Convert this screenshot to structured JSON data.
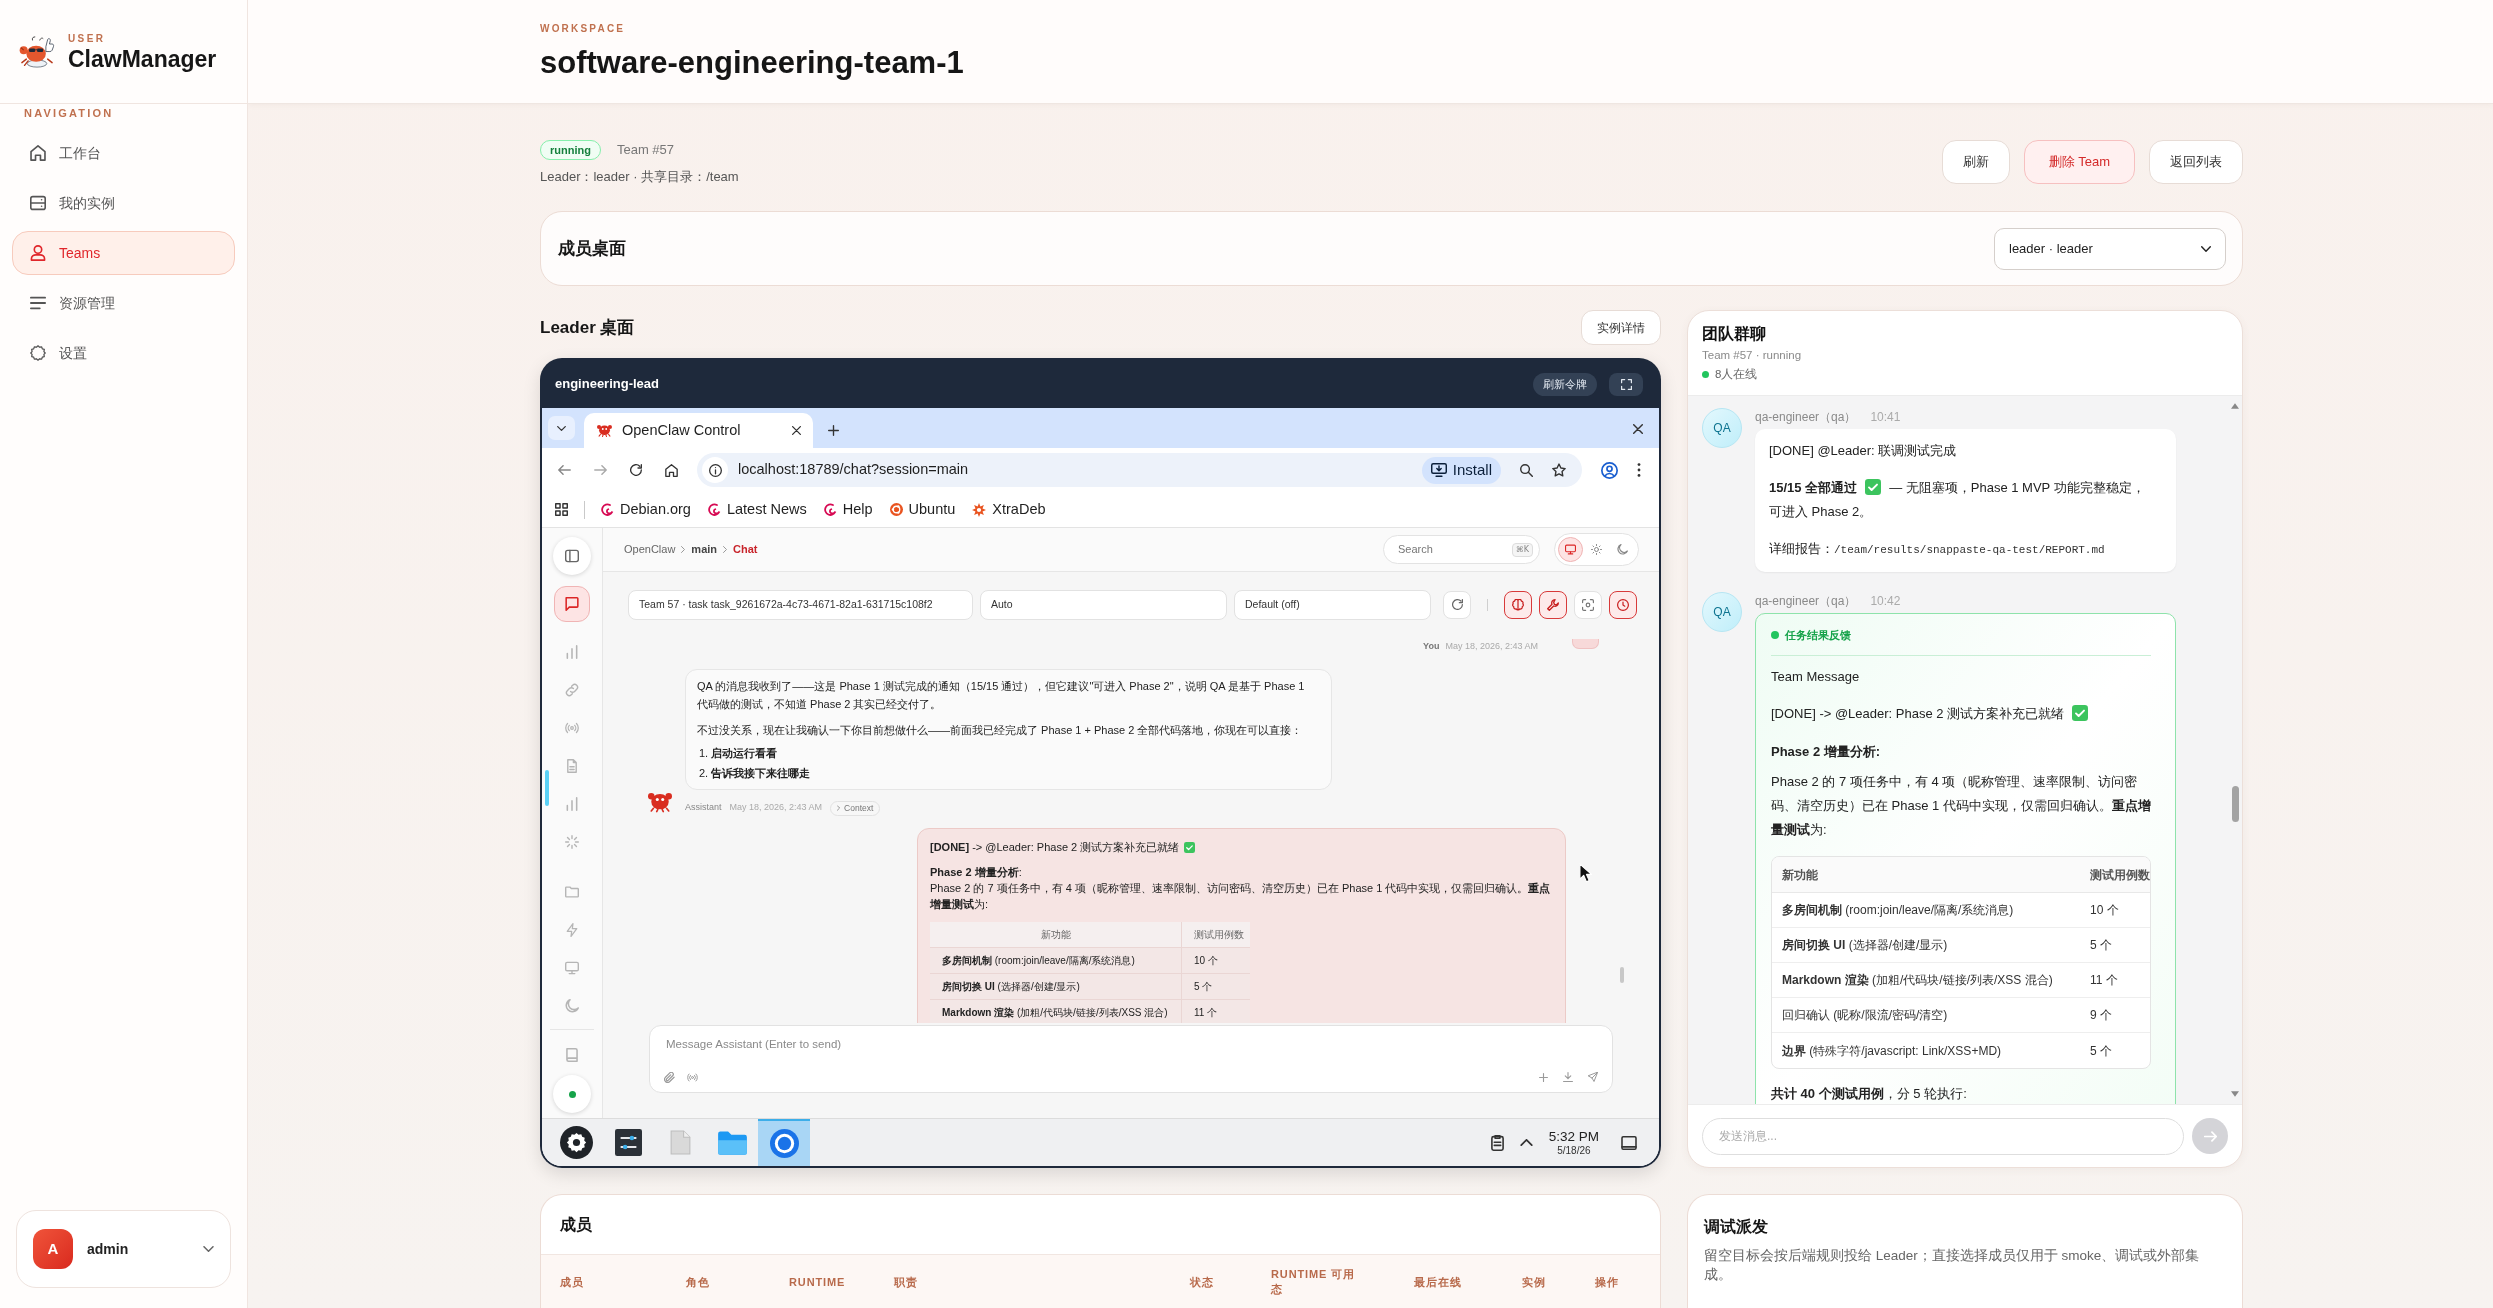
{
  "sidebar": {
    "brand_tag": "USER",
    "brand": "ClawManager",
    "nav_heading": "NAVIGATION",
    "items": [
      {
        "label": "工作台",
        "selected": false
      },
      {
        "label": "我的实例",
        "selected": false
      },
      {
        "label": "Teams",
        "selected": true
      },
      {
        "label": "资源管理",
        "selected": false
      },
      {
        "label": "设置",
        "selected": false
      }
    ],
    "user": {
      "avatar": "A",
      "name": "admin"
    }
  },
  "header": {
    "eyebrow": "WORKSPACE",
    "title": "software-engineering-team-1"
  },
  "team": {
    "status": "running",
    "number": "Team #57",
    "meta": "Leader：leader · 共享目录：/team",
    "actions": [
      {
        "label": "刷新",
        "kind": "plain"
      },
      {
        "label": "删除 Team",
        "kind": "danger"
      },
      {
        "label": "返回列表",
        "kind": "plain"
      }
    ]
  },
  "member_desktop": {
    "title": "成员桌面",
    "selected_member": "leader · leader"
  },
  "desktop": {
    "title": "Leader 桌面",
    "details_button": "实例详情",
    "window": {
      "title": "engineering-lead",
      "refresh_button": "刷新令牌"
    },
    "browser": {
      "tab_title": "OpenClaw Control",
      "url": "localhost:18789/chat?session=main",
      "install_button": "Install",
      "bookmarks": [
        {
          "label": "Debian.org",
          "kind": "swirl"
        },
        {
          "label": "Latest News",
          "kind": "swirl"
        },
        {
          "label": "Help",
          "kind": "swirl"
        },
        {
          "label": "Ubuntu",
          "kind": "ring"
        },
        {
          "label": "XtraDeb",
          "kind": "burst"
        }
      ]
    },
    "app": {
      "rail": [
        {
          "selected": false
        },
        {
          "selected": true
        },
        {
          "selected": false
        },
        {
          "selected": false
        },
        {
          "selected": false
        },
        {
          "selected": false
        },
        {
          "selected": false
        },
        {
          "selected": false
        },
        {
          "selected": false
        },
        {
          "selected": false
        },
        {
          "selected": false
        },
        {
          "selected": false
        },
        {
          "selected": false
        },
        {
          "selected": false
        }
      ],
      "breadcrumb": [
        {
          "label": "OpenClaw",
          "selected": false
        },
        {
          "label": "main",
          "selected": false
        },
        {
          "label": "Chat",
          "selected": true
        }
      ],
      "search": {
        "placeholder": "Search",
        "shortcut": "⌘K"
      },
      "theme_modes": [
        {
          "selected": true
        },
        {
          "selected": false
        },
        {
          "selected": false
        }
      ],
      "selects": [
        "Team 57 · task task_9261672a-4c73-4671-82a1-631715c108f2",
        "Auto",
        "Default (off)"
      ],
      "toggles": [
        {
          "on": true
        },
        {
          "on": true
        },
        {
          "on": false
        },
        {
          "on": true
        }
      ],
      "messages": [
        {
          "kind": "meta",
          "sender": "You",
          "time": "May 18, 2026, 2:43 AM"
        },
        {
          "kind": "assistant",
          "paragraphs": [
            "QA 的消息我收到了——这是 Phase 1 测试完成的通知（15/15 通过），但它建议\"可进入 Phase 2\"，说明 QA 是基于 Phase 1 代码做的测试，不知道 Phase 2 其实已经交付了。",
            "不过没关系，现在让我确认一下你目前想做什么——前面我已经完成了 Phase 1 + Phase 2 全部代码落地，你现在可以直接："
          ],
          "list": [
            {
              "marker": "1.",
              "text": "启动运行看看"
            },
            {
              "marker": "2.",
              "text": "告诉我接下来往哪走"
            }
          ],
          "sender": "Assistant",
          "time": "May 18, 2026, 2:43 AM",
          "context_button": "Context"
        },
        {
          "kind": "user",
          "blocks": [
            {
              "kind": "text",
              "text": "**[DONE]** -> @Leader: Phase 2 测试方案补充已就绪",
              "check_mark": true
            },
            {
              "kind": "text",
              "text": "**Phase 2 增量分析**:\nPhase 2 的 7 项任务中，有 4 项（昵称管理、速率限制、访问密码、清空历史）已在 Phase 1 代码中实现，仅需回归确认。**重点增量测试**为:"
            },
            {
              "kind": "table",
              "columns": [
                "新功能",
                "测试用例数"
              ],
              "rows": [
                [
                  "**多房间机制** (room:join/leave/隔离/系统消息)",
                  "10 个"
                ],
                [
                  "**房间切换 UI** (选择器/创建/显示)",
                  "5 个"
                ],
                [
                  "**Markdown 渲染** (加粗/代码块/链接/列表/XSS 混合)",
                  "11 个"
                ]
              ]
            }
          ]
        }
      ],
      "composer": {
        "placeholder": "Message Assistant (Enter to send)"
      }
    },
    "taskbar": {
      "apps": [
        {
          "selected": false
        },
        {
          "selected": false
        },
        {
          "selected": false
        },
        {
          "selected": false
        },
        {
          "selected": true
        }
      ],
      "time": "5:32 PM",
      "date": "5/18/26"
    }
  },
  "chat": {
    "title": "团队群聊",
    "subtitle": "Team #57 · running",
    "online": "8人在线",
    "messages": [
      {
        "kind": "plain",
        "avatar": "QA",
        "sender": "qa-engineer（qa）",
        "time": "10:41",
        "blocks": [
          {
            "kind": "text",
            "text": "[DONE] @Leader: 联调测试完成"
          },
          {
            "kind": "text",
            "text": "**15/15 全部通过**",
            "check_mark": true,
            "after": "— 无阻塞项，Phase 1 MVP 功能完整稳定，可进入 Phase 2。"
          },
          {
            "kind": "report",
            "text": "详细报告：",
            "path": "/team/results/snappaste-qa-test/REPORT.md"
          }
        ]
      },
      {
        "kind": "result",
        "avatar": "QA",
        "sender": "qa-engineer（qa）",
        "time": "10:42",
        "label": "任务结果反馈",
        "blocks": [
          {
            "kind": "text",
            "text": "Team Message"
          },
          {
            "kind": "text",
            "text": "[DONE] -> @Leader: Phase 2 测试方案补充已就绪",
            "check_mark": true
          },
          {
            "kind": "heading",
            "text": "Phase 2 增量分析:"
          },
          {
            "kind": "text",
            "text": "Phase 2 的 7 项任务中，有 4 项（昵称管理、速率限制、访问密码、清空历史）已在 Phase 1 代码中实现，仅需回归确认。**重点增量测试**为:"
          },
          {
            "kind": "table",
            "columns": [
              "新功能",
              "测试用例数"
            ],
            "rows": [
              [
                "**多房间机制** (room:join/leave/隔离/系统消息)",
                "10 个"
              ],
              [
                "**房间切换 UI** (选择器/创建/显示)",
                "5 个"
              ],
              [
                "**Markdown 渲染** (加粗/代码块/链接/列表/XSS 混合)",
                "11 个"
              ],
              [
                "回归确认 (昵称/限流/密码/清空)",
                "9 个"
              ],
              [
                "**边界** (特殊字符/javascript: Link/XSS+MD)",
                "5 个"
              ]
            ]
          },
          {
            "kind": "text",
            "text": "**共计 40 个测试用例**，分 5 轮执行:"
          }
        ]
      }
    ],
    "input_placeholder": "发送消息..."
  },
  "members": {
    "title": "成员",
    "columns": [
      "成员",
      "角色",
      "RUNTIME",
      "职责",
      "状态",
      "RUNTIME 可用态",
      "最后在线",
      "实例",
      "操作"
    ]
  },
  "dispatch": {
    "title": "调试派发",
    "description": "留空目标会按后端规则投给 Leader；直接选择成员仅用于 smoke、调试或外部集成。"
  }
}
